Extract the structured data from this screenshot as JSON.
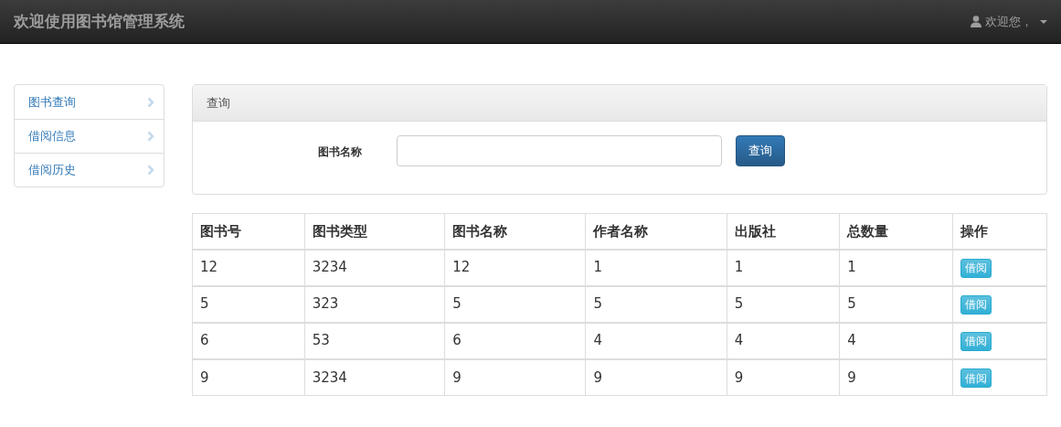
{
  "navbar": {
    "brand": "欢迎使用图书馆管理系统",
    "user_menu": "欢迎您，"
  },
  "sidebar": {
    "items": [
      {
        "label": "图书查询"
      },
      {
        "label": "借阅信息"
      },
      {
        "label": "借阅历史"
      }
    ]
  },
  "search_panel": {
    "title": "查询",
    "field_label": "图书名称",
    "button": "查询"
  },
  "table": {
    "columns": [
      "图书号",
      "图书类型",
      "图书名称",
      "作者名称",
      "出版社",
      "总数量",
      "操作"
    ],
    "rows": [
      {
        "cells": [
          "12",
          "3234",
          "12",
          "1",
          "1",
          "1"
        ],
        "action": "借阅"
      },
      {
        "cells": [
          "5",
          "323",
          "5",
          "5",
          "5",
          "5"
        ],
        "action": "借阅"
      },
      {
        "cells": [
          "6",
          "53",
          "6",
          "4",
          "4",
          "4"
        ],
        "action": "借阅"
      },
      {
        "cells": [
          "9",
          "3234",
          "9",
          "9",
          "9",
          "9"
        ],
        "action": "借阅"
      }
    ]
  }
}
